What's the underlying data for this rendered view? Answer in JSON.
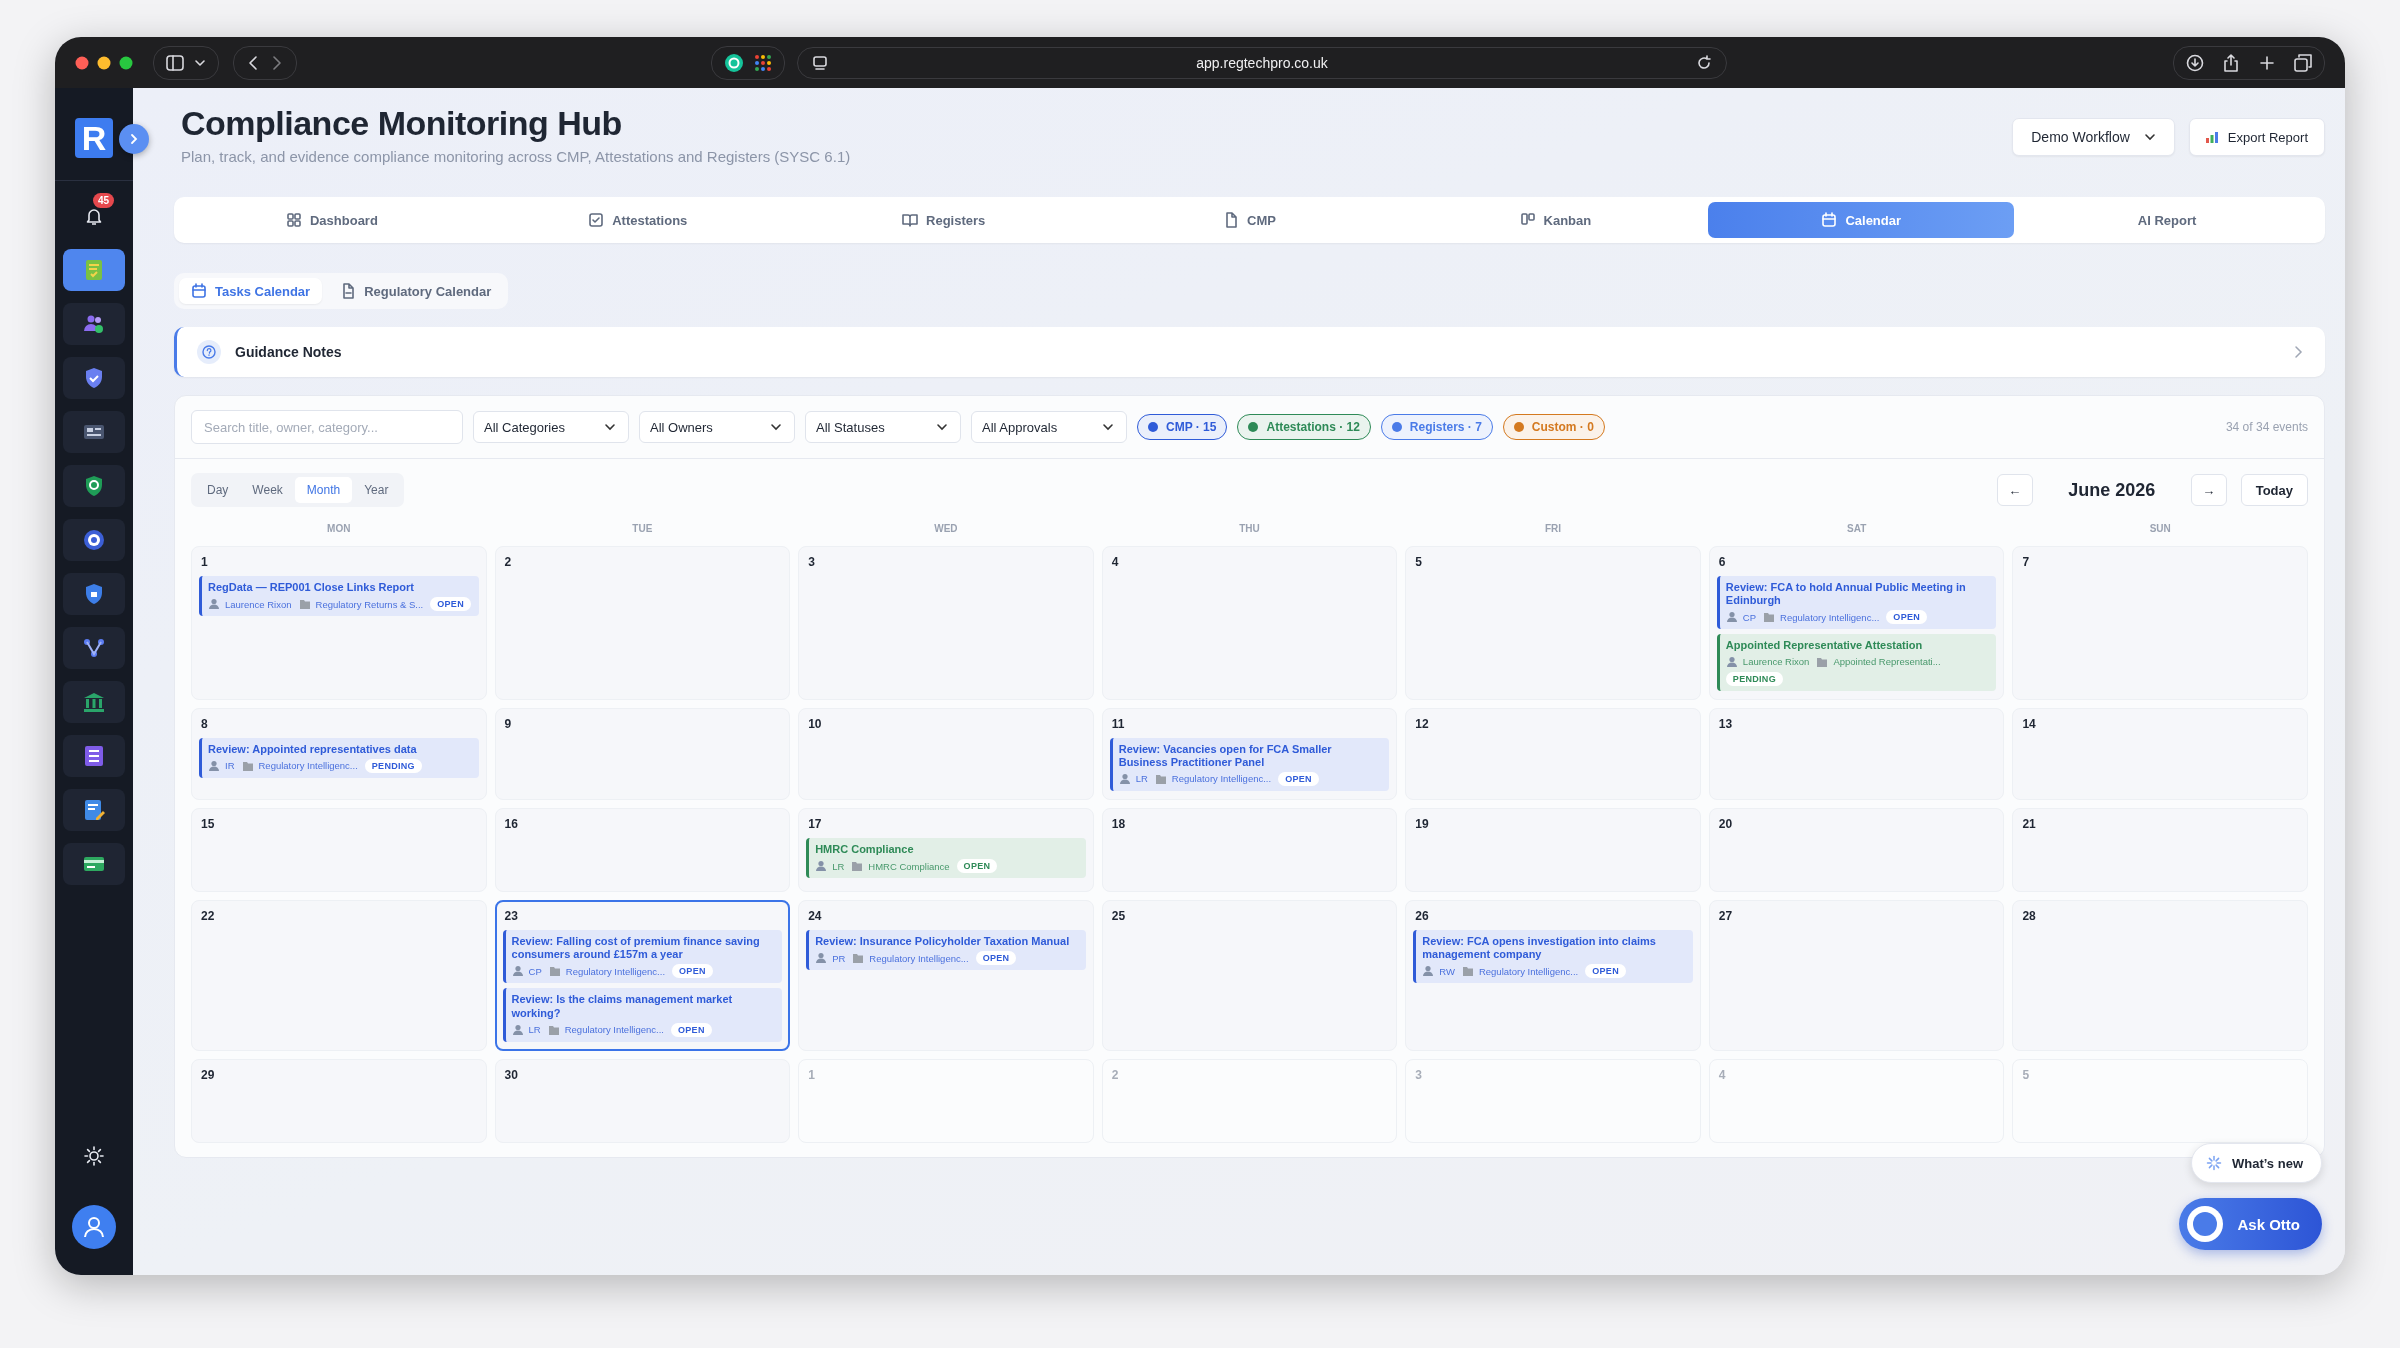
{
  "browser": {
    "url": "app.regtechpro.co.uk"
  },
  "sidebar": {
    "logo": "R",
    "notifications": "45",
    "items": [
      {
        "selected": true
      },
      {
        "selected": false
      },
      {
        "selected": false
      },
      {
        "selected": false
      },
      {
        "selected": false
      },
      {
        "selected": false
      },
      {
        "selected": false
      },
      {
        "selected": false
      },
      {
        "selected": false
      },
      {
        "selected": false
      },
      {
        "selected": false
      },
      {
        "selected": false
      }
    ]
  },
  "header": {
    "title": "Compliance Monitoring Hub",
    "subtitle": "Plan, track, and evidence compliance monitoring across CMP, Attestations and Registers (SYSC 6.1)",
    "workflow": "Demo Workflow",
    "export": "Export Report"
  },
  "tabs": [
    {
      "label": "Dashboard",
      "selected": false
    },
    {
      "label": "Attestations",
      "selected": false
    },
    {
      "label": "Registers",
      "selected": false
    },
    {
      "label": "CMP",
      "selected": false
    },
    {
      "label": "Kanban",
      "selected": false
    },
    {
      "label": "Calendar",
      "selected": true
    },
    {
      "label": "AI Report",
      "selected": false
    }
  ],
  "subtabs": [
    {
      "label": "Tasks Calendar",
      "selected": true
    },
    {
      "label": "Regulatory Calendar",
      "selected": false
    }
  ],
  "guidance": {
    "title": "Guidance Notes"
  },
  "filters": {
    "search": {
      "placeholder": "Search title, owner, category..."
    },
    "dropdowns": [
      "All Categories",
      "All Owners",
      "All Statuses",
      "All Approvals"
    ],
    "legend": [
      {
        "label": "CMP · 15",
        "color": "#2f5bd8"
      },
      {
        "label": "Attestations · 12",
        "color": "#2e8a57"
      },
      {
        "label": "Registers · 7",
        "color": "#4a7be8"
      },
      {
        "label": "Custom · 0",
        "color": "#d4791f"
      }
    ],
    "count": "34 of 34 events"
  },
  "views": [
    {
      "label": "Day",
      "selected": false
    },
    {
      "label": "Week",
      "selected": false
    },
    {
      "label": "Month",
      "selected": true
    },
    {
      "label": "Year",
      "selected": false
    }
  ],
  "nav": {
    "prev": "←",
    "month": "June 2026",
    "next": "→",
    "today": "Today"
  },
  "weekdays": [
    "MON",
    "TUE",
    "WED",
    "THU",
    "FRI",
    "SAT",
    "SUN"
  ],
  "days": [
    {
      "day": "1",
      "outside": false,
      "selected": false,
      "events": [
        {
          "title": "RegData — REP001 Close Links Report",
          "owner": "Laurence Rixon",
          "category": "Regulatory Returns & S...",
          "status": "OPEN",
          "color": "#2f5bd8"
        }
      ]
    },
    {
      "day": "2",
      "outside": false,
      "selected": false
    },
    {
      "day": "3",
      "outside": false,
      "selected": false
    },
    {
      "day": "4",
      "outside": false,
      "selected": false
    },
    {
      "day": "5",
      "outside": false,
      "selected": false
    },
    {
      "day": "6",
      "outside": false,
      "selected": false,
      "events": [
        {
          "title": "Review: FCA to hold Annual Public Meeting in Edinburgh",
          "owner": "CP",
          "category": "Regulatory Intelligenc...",
          "status": "OPEN",
          "color": "#2f5bd8"
        },
        {
          "title": "Appointed Representative Attestation",
          "owner": "Laurence Rixon",
          "category": "Appointed Representati...",
          "status": "PENDING",
          "color": "#2e8a57"
        }
      ]
    },
    {
      "day": "7",
      "outside": false,
      "selected": false
    },
    {
      "day": "8",
      "outside": false,
      "selected": false,
      "events": [
        {
          "title": "Review: Appointed representatives data",
          "owner": "IR",
          "category": "Regulatory Intelligenc...",
          "status": "PENDING",
          "color": "#2f5bd8"
        }
      ]
    },
    {
      "day": "9",
      "outside": false,
      "selected": false
    },
    {
      "day": "10",
      "outside": false,
      "selected": false
    },
    {
      "day": "11",
      "outside": false,
      "selected": false,
      "events": [
        {
          "title": "Review: Vacancies open for FCA Smaller Business Practitioner Panel",
          "owner": "LR",
          "category": "Regulatory Intelligenc...",
          "status": "OPEN",
          "color": "#2f5bd8"
        }
      ]
    },
    {
      "day": "12",
      "outside": false,
      "selected": false
    },
    {
      "day": "13",
      "outside": false,
      "selected": false
    },
    {
      "day": "14",
      "outside": false,
      "selected": false
    },
    {
      "day": "15",
      "outside": false,
      "selected": false
    },
    {
      "day": "16",
      "outside": false,
      "selected": false
    },
    {
      "day": "17",
      "outside": false,
      "selected": false,
      "events": [
        {
          "title": "HMRC Compliance",
          "owner": "LR",
          "category": "HMRC Compliance",
          "status": "OPEN",
          "color": "#2e8a57"
        }
      ]
    },
    {
      "day": "18",
      "outside": false,
      "selected": false
    },
    {
      "day": "19",
      "outside": false,
      "selected": false
    },
    {
      "day": "20",
      "outside": false,
      "selected": false
    },
    {
      "day": "21",
      "outside": false,
      "selected": false
    },
    {
      "day": "22",
      "outside": false,
      "selected": false
    },
    {
      "day": "23",
      "outside": false,
      "selected": true,
      "events": [
        {
          "title": "Review: Falling cost of premium finance saving consumers around £157m a year",
          "owner": "CP",
          "category": "Regulatory Intelligenc...",
          "status": "OPEN",
          "color": "#2f5bd8"
        },
        {
          "title": "Review: Is the claims management market working?",
          "owner": "LR",
          "category": "Regulatory Intelligenc...",
          "status": "OPEN",
          "color": "#2f5bd8"
        }
      ]
    },
    {
      "day": "24",
      "outside": false,
      "selected": false,
      "events": [
        {
          "title": "Review: Insurance Policyholder Taxation Manual",
          "owner": "PR",
          "category": "Regulatory Intelligenc...",
          "status": "OPEN",
          "color": "#2f5bd8"
        }
      ]
    },
    {
      "day": "25",
      "outside": false,
      "selected": false
    },
    {
      "day": "26",
      "outside": false,
      "selected": false,
      "events": [
        {
          "title": "Review: FCA opens investigation into claims management company",
          "owner": "RW",
          "category": "Regulatory Intelligenc...",
          "status": "OPEN",
          "color": "#2f5bd8"
        }
      ]
    },
    {
      "day": "27",
      "outside": false,
      "selected": false
    },
    {
      "day": "28",
      "outside": false,
      "selected": false
    },
    {
      "day": "29",
      "outside": false,
      "selected": false
    },
    {
      "day": "30",
      "outside": false,
      "selected": false
    },
    {
      "day": "1",
      "outside": true,
      "selected": false
    },
    {
      "day": "2",
      "outside": true,
      "selected": false
    },
    {
      "day": "3",
      "outside": true,
      "selected": false
    },
    {
      "day": "4",
      "outside": true,
      "selected": false
    },
    {
      "day": "5",
      "outside": true,
      "selected": false
    }
  ],
  "floating": {
    "whats_new": "What’s new",
    "assistant": "Ask Otto"
  }
}
